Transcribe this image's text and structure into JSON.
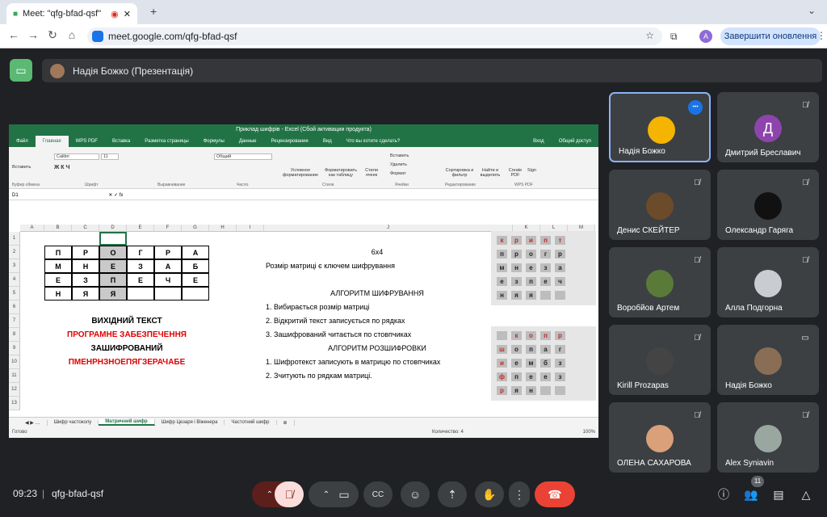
{
  "browser": {
    "tab_title": "Meet: \"qfg-bfad-qsf\"",
    "url": "meet.google.com/qfg-bfad-qsf",
    "update_label": "Завершити оновлення",
    "profile_letter": "A"
  },
  "meet": {
    "presenter": "Надія Божко (Презентація)",
    "time": "09:23",
    "meeting_code": "qfg-bfad-qsf",
    "participants_count": "11"
  },
  "excel": {
    "title": "Приклад шифрів - Excel (Сбой активации продукта)",
    "menu": [
      "Файл",
      "Главная",
      "WPS PDF",
      "Вставка",
      "Разметка страницы",
      "Формулы",
      "Данные",
      "Рецензирование",
      "Вид",
      "Что вы хотите сделать?",
      "Вход",
      "Общий доступ"
    ],
    "ribbon": {
      "paste": "Вставить",
      "font": "Calibri",
      "size": "11",
      "number_format": "Общий",
      "cond": "Условное форматирование",
      "table": "Форматировать как таблицу",
      "styles": "Стили ячеек",
      "insert": "Вставить",
      "delete": "Удалить",
      "format": "Формат",
      "sort": "Сортировка и фильтр",
      "find": "Найти и выделить",
      "create_pdf": "Create PDF",
      "sign": "Sign",
      "groups": [
        "Буфер обмена",
        "Шрифт",
        "Выравнивание",
        "Число",
        "Стили",
        "Ячейки",
        "Редактирование",
        "WPS PDF"
      ]
    },
    "cell_ref": "D1",
    "columns": [
      "A",
      "B",
      "C",
      "D",
      "E",
      "F",
      "G",
      "H",
      "I",
      "J",
      "K",
      "L",
      "M"
    ],
    "rows": [
      "1",
      "2",
      "3",
      "4",
      "5",
      "6",
      "7",
      "8",
      "9",
      "10",
      "11",
      "12",
      "13"
    ],
    "matrix": [
      [
        "П",
        "Р",
        "О",
        "Г",
        "Р",
        "А"
      ],
      [
        "М",
        "Н",
        "Е",
        "З",
        "А",
        "Б"
      ],
      [
        "Е",
        "З",
        "П",
        "Е",
        "Ч",
        "Е"
      ],
      [
        "Н",
        "Я",
        "Я",
        "",
        "",
        ""
      ]
    ],
    "labels": {
      "source": "ВИХІДНИЙ ТЕКСТ",
      "program": "ПРОГРАМНЕ ЗАБЕЗПЕЧЕННЯ",
      "encrypted": "ЗАШИФРОВАНИЙ",
      "cipher": "ПМЕНРНЗНОЕПЯГЗЕРАЧАБЕ"
    },
    "j": [
      "",
      "6x4",
      "Розмір матриці є ключем шифрування",
      "",
      "АЛГОРИТМ ШИФРУВАННЯ",
      "1. Вибирається розмір матриці",
      "2. Відкритий текст записується по рядках",
      "3. Зашифрований читається по стовпчиках",
      "АЛГОРИТМ РОЗШИФРОВКИ",
      "1. Шифротекст записують в матрицю по стовпчиках",
      "2. Зчитують по рядкам матриці.",
      "",
      ""
    ],
    "pic1": [
      [
        "к",
        "р",
        "и",
        "п",
        "т"
      ],
      [
        "п",
        "р",
        "о",
        "г",
        "р"
      ],
      [
        "м",
        "н",
        "е",
        "з",
        "а"
      ],
      [
        "е",
        "з",
        "п",
        "е",
        "ч"
      ],
      [
        "н",
        "я",
        "я",
        "",
        ""
      ]
    ],
    "pic2": [
      [
        "",
        "к",
        "о",
        "п",
        "р"
      ],
      [
        "ш",
        "о",
        "п",
        "а",
        "г"
      ],
      [
        "и",
        "е",
        "м",
        "б",
        "з"
      ],
      [
        "ф",
        "п",
        "е",
        "е",
        "з"
      ],
      [
        "р",
        "я",
        "н",
        "",
        ""
      ]
    ],
    "sheets": [
      "Шифр частоколу",
      "Матричний шифр",
      "Шифр Цезаря і Віженера",
      "Частотний шифр"
    ],
    "status": {
      "ready": "Готово",
      "count": "Количество: 4",
      "zoom": "100%"
    }
  },
  "participants": [
    {
      "name": "Надія Божко",
      "initial": "",
      "color": "#f4b400"
    },
    {
      "name": "Дмитрий Бреславич",
      "initial": "Д",
      "color": "#8e44ad"
    },
    {
      "name": "Денис СКЕЙТЕР",
      "initial": "",
      "color": "#6b4b2a"
    },
    {
      "name": "Олександр Гаряга",
      "initial": "",
      "color": "#111"
    },
    {
      "name": "Воробйов Артем",
      "initial": "",
      "color": "#5a7a3a"
    },
    {
      "name": "Алла Подгорна",
      "initial": "",
      "color": "#c9cdd2"
    },
    {
      "name": "Kirill Prozapas",
      "initial": "",
      "color": "#444"
    },
    {
      "name": "Надія Божко",
      "initial": "",
      "color": "#8a6d55"
    },
    {
      "name": "ОЛЕНА САХАРОВА",
      "initial": "",
      "color": "#d9a07a"
    },
    {
      "name": "Alex Syniavin",
      "initial": "",
      "color": "#9aa6a0"
    }
  ]
}
